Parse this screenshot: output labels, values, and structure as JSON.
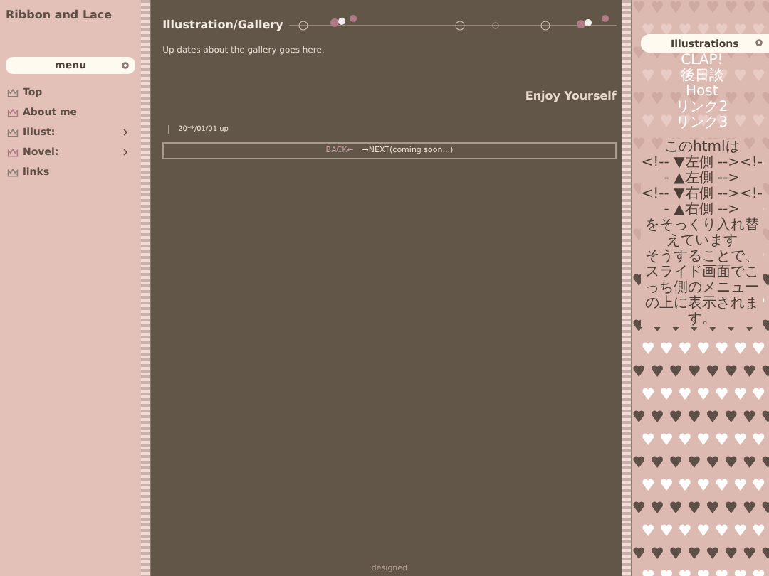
{
  "site_title": "Ribbon and Lace",
  "menu": {
    "title": "menu",
    "items": [
      {
        "label": "Top",
        "has_submenu": false
      },
      {
        "label": "About me",
        "has_submenu": false
      },
      {
        "label": "Illust:",
        "has_submenu": true
      },
      {
        "label": "Novel:",
        "has_submenu": true
      },
      {
        "label": "links",
        "has_submenu": false
      }
    ]
  },
  "main": {
    "title": "Illustration/Gallery",
    "intro": "Up dates about the gallery goes here.",
    "heading": "Enjoy Yourself",
    "entry": "20**/01/01 up",
    "nav": {
      "back": "BACK←",
      "next": "→NEXT(coming soon...)"
    },
    "footer": "designed"
  },
  "right": {
    "title": "Illustrations",
    "links": [
      "CLAP!",
      "後日談",
      "Host",
      "リンク2",
      "リンク3"
    ],
    "notes": [
      "このhtmlは",
      "<!-- ▼左側 --><!-- ▲左側 -->",
      "<!-- ▼右側 --><!-- ▲右側 -->",
      "をそっくり入れ替えています",
      "そうすることで、スライド画面でこっち側のメニューの上に表示されます。"
    ]
  }
}
